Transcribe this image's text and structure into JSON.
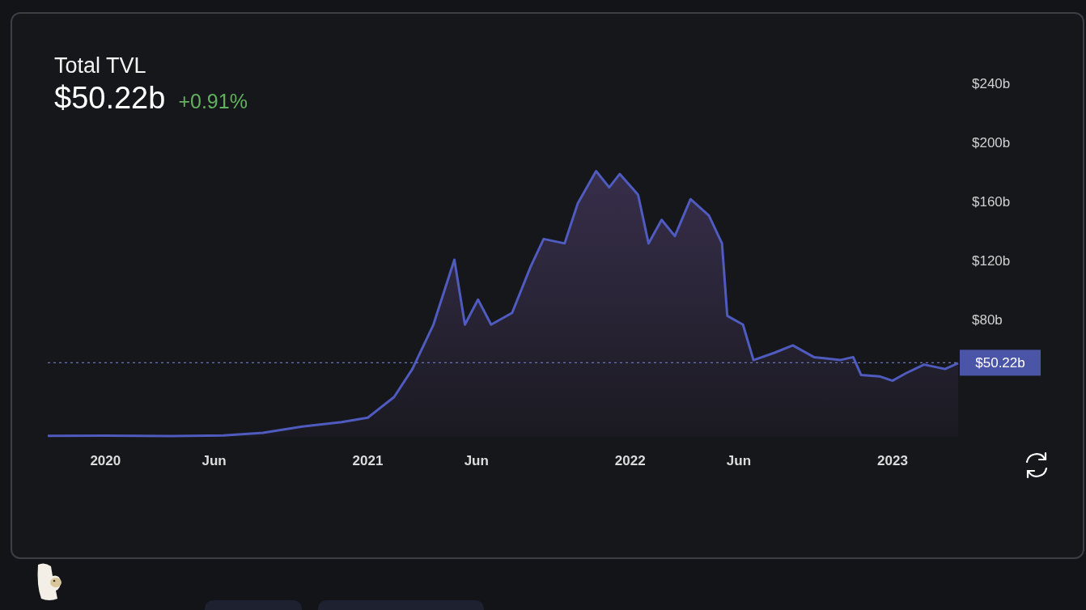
{
  "header": {
    "title": "Total TVL",
    "value": "$50.22b",
    "change": "+0.91%"
  },
  "chart": {
    "chart_data": {
      "type": "area",
      "xlim": [
        2019.78,
        2023.25
      ],
      "ylim": [
        0,
        240
      ],
      "xticks": [
        {
          "value": 2020,
          "label": "2020"
        },
        {
          "value": 2020.414,
          "label": "Jun"
        },
        {
          "value": 2021,
          "label": "2021"
        },
        {
          "value": 2021.414,
          "label": "Jun"
        },
        {
          "value": 2022,
          "label": "2022"
        },
        {
          "value": 2022.414,
          "label": "Jun"
        },
        {
          "value": 2023,
          "label": "2023"
        }
      ],
      "yticks": [
        {
          "value": 80,
          "label": "$80b"
        },
        {
          "value": 120,
          "label": "$120b"
        },
        {
          "value": 160,
          "label": "$160b"
        },
        {
          "value": 200,
          "label": "$200b"
        },
        {
          "value": 240,
          "label": "$240b"
        }
      ],
      "x": [
        2019.78,
        2020.0,
        2020.25,
        2020.45,
        2020.6,
        2020.75,
        2020.9,
        2021.0,
        2021.1,
        2021.17,
        2021.25,
        2021.33,
        2021.37,
        2021.42,
        2021.47,
        2021.55,
        2021.62,
        2021.67,
        2021.75,
        2021.8,
        2021.87,
        2021.92,
        2021.96,
        2022.03,
        2022.07,
        2022.12,
        2022.17,
        2022.23,
        2022.3,
        2022.35,
        2022.37,
        2022.43,
        2022.47,
        2022.55,
        2022.62,
        2022.7,
        2022.8,
        2022.85,
        2022.88,
        2022.95,
        2023.0,
        2023.05,
        2023.12,
        2023.2,
        2023.25
      ],
      "series": [
        {
          "color": "#4f5bbf",
          "values": [
            0.7,
            0.8,
            0.6,
            1,
            2.7,
            7,
            10,
            13,
            27,
            46,
            76,
            120,
            76,
            93,
            76,
            84,
            115,
            134,
            131,
            158,
            180,
            169,
            178,
            164,
            131,
            147,
            136,
            161,
            150,
            131,
            82,
            76,
            52,
            57,
            62,
            54,
            52,
            54,
            42,
            41,
            38,
            43,
            49,
            46,
            50
          ]
        }
      ],
      "ref_lines": [
        {
          "axis": "y",
          "value": 50.22,
          "label": "$50.22b"
        }
      ]
    }
  }
}
